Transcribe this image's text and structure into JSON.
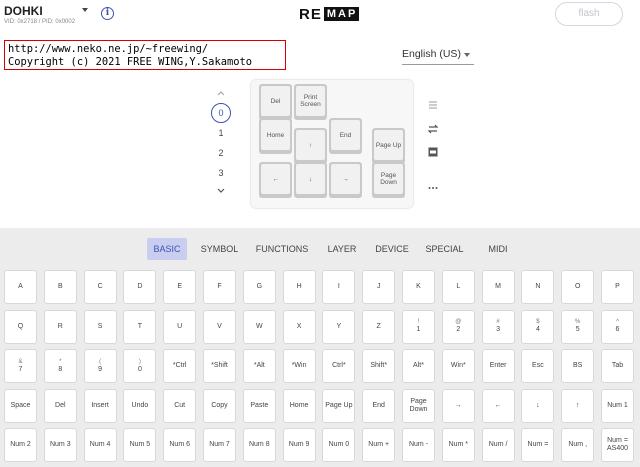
{
  "header": {
    "device_name": "DOHKI",
    "device_ids": "VID: 0x2718 / PID: 0x0002",
    "logo_re": "RE",
    "logo_map": "MAP",
    "flash_label": "flash"
  },
  "copyright": {
    "line1": "http://www.neko.ne.jp/~freewing/",
    "line2": "Copyright (c) 2021 FREE WING,Y.Sakamoto"
  },
  "language": {
    "selected": "English (US)"
  },
  "layers": {
    "items": [
      "0",
      "1",
      "2",
      "3"
    ],
    "selected": "0"
  },
  "keyboard": {
    "keys": [
      "Del",
      "Print Screen",
      "Home",
      "↑",
      "End",
      "Page Up",
      "←",
      "↓",
      "→",
      "Page Down"
    ]
  },
  "tools": [
    "lines-icon",
    "swap-icon",
    "pdf-icon",
    "more-icon"
  ],
  "picker": {
    "tabs": [
      "BASIC",
      "SYMBOL",
      "FUNCTIONS",
      "LAYER",
      "DEVICE",
      "SPECIAL",
      "MIDI"
    ],
    "active_tab": "BASIC",
    "rows": [
      [
        {
          "m": "A"
        },
        {
          "m": "B"
        },
        {
          "m": "C"
        },
        {
          "m": "D"
        },
        {
          "m": "E"
        },
        {
          "m": "F"
        },
        {
          "m": "G"
        },
        {
          "m": "H"
        },
        {
          "m": "I"
        },
        {
          "m": "J"
        },
        {
          "m": "K"
        },
        {
          "m": "L"
        },
        {
          "m": "M"
        },
        {
          "m": "N"
        },
        {
          "m": "O"
        },
        {
          "m": "P"
        }
      ],
      [
        {
          "m": "Q"
        },
        {
          "m": "R"
        },
        {
          "m": "S"
        },
        {
          "m": "T"
        },
        {
          "m": "U"
        },
        {
          "m": "V"
        },
        {
          "m": "W"
        },
        {
          "m": "X"
        },
        {
          "m": "Y"
        },
        {
          "m": "Z"
        },
        {
          "m": "1",
          "s": "!"
        },
        {
          "m": "2",
          "s": "@"
        },
        {
          "m": "3",
          "s": "#"
        },
        {
          "m": "4",
          "s": "$"
        },
        {
          "m": "5",
          "s": "%"
        },
        {
          "m": "6",
          "s": "^"
        }
      ],
      [
        {
          "m": "7",
          "s": "&"
        },
        {
          "m": "8",
          "s": "*"
        },
        {
          "m": "9",
          "s": "("
        },
        {
          "m": "0",
          "s": ")"
        },
        {
          "m": "*Ctrl"
        },
        {
          "m": "*Shift"
        },
        {
          "m": "*Alt"
        },
        {
          "m": "*Win"
        },
        {
          "m": "Ctrl*"
        },
        {
          "m": "Shift*"
        },
        {
          "m": "Alt*"
        },
        {
          "m": "Win*"
        },
        {
          "m": "Enter"
        },
        {
          "m": "Esc"
        },
        {
          "m": "BS"
        },
        {
          "m": "Tab"
        }
      ],
      [
        {
          "m": "Space"
        },
        {
          "m": "Del"
        },
        {
          "m": "Insert"
        },
        {
          "m": "Undo"
        },
        {
          "m": "Cut"
        },
        {
          "m": "Copy"
        },
        {
          "m": "Paste"
        },
        {
          "m": "Home"
        },
        {
          "m": "Page Up"
        },
        {
          "m": "End"
        },
        {
          "m": "Page Down"
        },
        {
          "m": "→"
        },
        {
          "m": "←"
        },
        {
          "m": "↓"
        },
        {
          "m": "↑"
        },
        {
          "m": "Num 1"
        }
      ],
      [
        {
          "m": "Num 2"
        },
        {
          "m": "Num 3"
        },
        {
          "m": "Num 4"
        },
        {
          "m": "Num 5"
        },
        {
          "m": "Num 6"
        },
        {
          "m": "Num 7"
        },
        {
          "m": "Num 8"
        },
        {
          "m": "Num 9"
        },
        {
          "m": "Num 0"
        },
        {
          "m": "Num +"
        },
        {
          "m": "Num -"
        },
        {
          "m": "Num *"
        },
        {
          "m": "Num /"
        },
        {
          "m": "Num ="
        },
        {
          "m": "Num ,"
        },
        {
          "m": "Num = AS400"
        }
      ]
    ]
  },
  "colors": {
    "accent": "#3f51b5",
    "tab_active_bg": "#c9cdf0",
    "copyright_border": "#d50000"
  }
}
